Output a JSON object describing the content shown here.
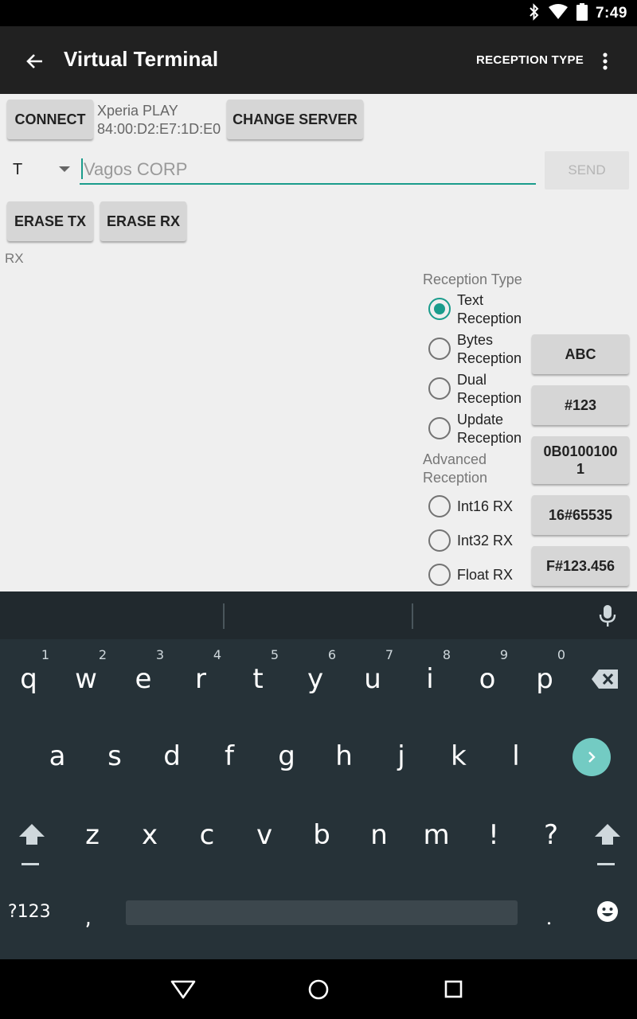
{
  "status_bar": {
    "time": "7:49",
    "icons": [
      "bluetooth-icon",
      "wifi-icon",
      "battery-icon"
    ]
  },
  "app_bar": {
    "title": "Virtual Terminal",
    "reception_type_action": "RECEPTION TYPE"
  },
  "connection": {
    "connect_label": "CONNECT",
    "device_name": "Xperia PLAY",
    "device_address": "84:00:D2:E7:1D:E0",
    "change_server_label": "CHANGE SERVER"
  },
  "send_row": {
    "type_value": "T",
    "input_value": "Vagos CORP",
    "send_label": "SEND"
  },
  "erase": {
    "erase_tx_label": "ERASE TX",
    "erase_rx_label": "ERASE RX"
  },
  "rx_label": "RX",
  "reception": {
    "section_title": "Reception Type",
    "options": [
      {
        "line1": "Text",
        "line2": "Reception",
        "selected": true
      },
      {
        "line1": "Bytes",
        "line2": "Reception",
        "selected": false
      },
      {
        "line1": "Dual",
        "line2": "Reception",
        "selected": false
      },
      {
        "line1": "Update",
        "line2": "Reception",
        "selected": false
      }
    ],
    "advanced_title_line1": "Advanced",
    "advanced_title_line2": "Reception",
    "advanced_options": [
      {
        "label": "Int16 RX",
        "selected": false
      },
      {
        "label": "Int32 RX",
        "selected": false
      },
      {
        "label": "Float RX",
        "selected": false
      }
    ],
    "format_buttons": [
      "ABC",
      "#123",
      "0B0100100\n1",
      "16#65535",
      "F#123.456"
    ]
  },
  "keyboard": {
    "row1": [
      "q",
      "w",
      "e",
      "r",
      "t",
      "y",
      "u",
      "i",
      "o",
      "p"
    ],
    "row1_hints": [
      "1",
      "2",
      "3",
      "4",
      "5",
      "6",
      "7",
      "8",
      "9",
      "0"
    ],
    "row2": [
      "a",
      "s",
      "d",
      "f",
      "g",
      "h",
      "j",
      "k",
      "l"
    ],
    "row3": [
      "z",
      "x",
      "c",
      "v",
      "b",
      "n",
      "m",
      "!",
      "?"
    ],
    "symbols_key": "?123",
    "comma_key": ",",
    "period_key": "."
  },
  "colors": {
    "accent": "#1a9c8c",
    "app_bar": "#212121",
    "keyboard_bg": "#263238",
    "enter_key": "#73cbc3"
  }
}
